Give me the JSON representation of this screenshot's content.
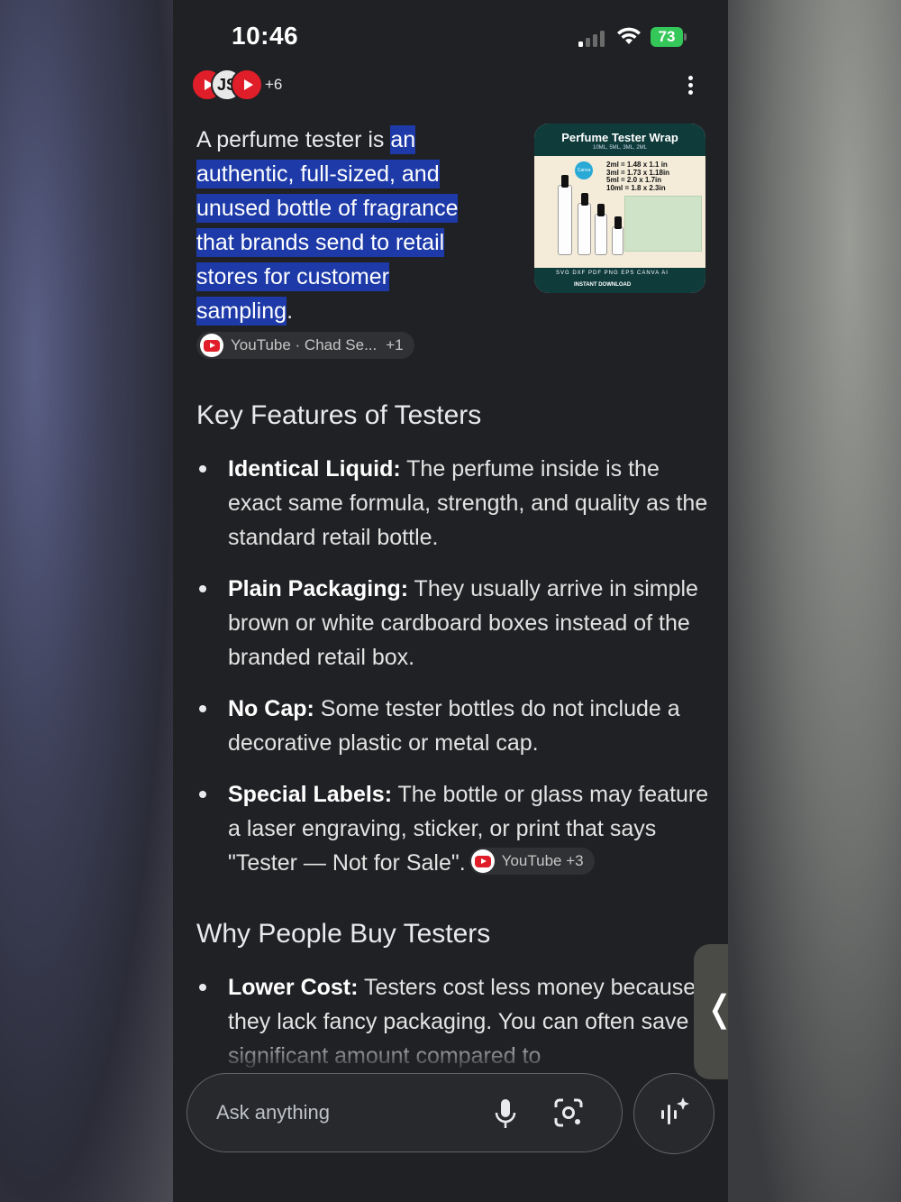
{
  "status_bar": {
    "time": "10:46",
    "battery": "73"
  },
  "sources": {
    "avatar_js": "JS",
    "more_count": "+6"
  },
  "intro": {
    "lead": "A perfume tester is ",
    "highlight_1": "an",
    "highlight_2": "authentic, full-sized, and",
    "highlight_3": "unused bottle of fragrance",
    "highlight_4": "that brands send to retail",
    "highlight_5": "stores for customer",
    "highlight_6": "sampling",
    "tail": "."
  },
  "intro_source_chip": {
    "label": "YouTube · Chad Se...",
    "plus": "+1"
  },
  "thumbnail": {
    "title": "Perfume Tester Wrap",
    "subtitle": "10ML, 5ML, 3ML, 2ML",
    "dims": [
      "2ml = 1.48 x 1.1 in",
      "3ml = 1.73 x 1.18in",
      "5ml = 2.0 x 1.7in",
      "10ml = 1.8 x 2.3in"
    ],
    "formats": "SVG  DXF  PDF  PNG  EPS  CANVA  AI",
    "download": "INSTANT DOWNLOAD"
  },
  "section1": {
    "heading": "Key Features of Testers",
    "items": [
      {
        "term": "Identical Liquid:",
        "text": " The perfume inside is the exact same formula, strength, and quality as the standard retail bottle."
      },
      {
        "term": "Plain Packaging:",
        "text": " They usually arrive in simple brown or white cardboard boxes instead of the branded retail box."
      },
      {
        "term": "No Cap:",
        "text": " Some tester bottles do not include a decorative plastic or metal cap."
      },
      {
        "term": "Special Labels:",
        "text": " The bottle or glass may feature a laser engraving, sticker, or print that says \"Tester — Not for Sale\"."
      }
    ],
    "chip_label": "YouTube",
    "chip_plus": "+3"
  },
  "section2": {
    "heading": "Why People Buy Testers",
    "items": [
      {
        "term": "Lower Cost:",
        "text": " Testers cost less money because they lack fancy packaging. You can often save a significant amount compared to"
      }
    ]
  },
  "ask": {
    "placeholder": "Ask anything"
  },
  "side_handle": {
    "glyph": "❬"
  }
}
